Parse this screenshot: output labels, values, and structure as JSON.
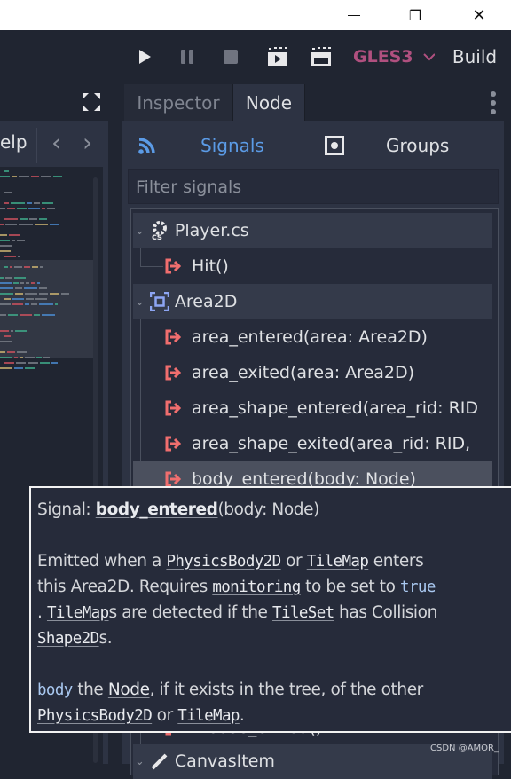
{
  "window_controls": {
    "minimize": "—",
    "restore": "❐",
    "close": "✕"
  },
  "toolbar": {
    "renderer": "GLES3",
    "build": "Build",
    "colors": {
      "renderer": "#b0507f"
    }
  },
  "left_panel": {
    "help_partial": "elp",
    "back": "‹",
    "forward": "›"
  },
  "dock": {
    "tabs": [
      {
        "label": "Inspector",
        "active": false
      },
      {
        "label": "Node",
        "active": true
      }
    ]
  },
  "node_panel": {
    "signals_label": "Signals",
    "groups_label": "Groups",
    "filter_placeholder": "Filter signals",
    "accent": "#5b9be6"
  },
  "tree": [
    {
      "label": "Player.cs",
      "type": "header",
      "icon": "csharp-script-icon"
    },
    {
      "label": "Hit()",
      "type": "signal"
    },
    {
      "label": "Area2D",
      "type": "header",
      "icon": "area2d-icon"
    },
    {
      "label": "area_entered(area: Area2D)",
      "type": "signal"
    },
    {
      "label": "area_exited(area: Area2D)",
      "type": "signal"
    },
    {
      "label": "area_shape_entered(area_rid: RID",
      "type": "signal"
    },
    {
      "label": "area_shape_exited(area_rid: RID,",
      "type": "signal"
    },
    {
      "label": "body_entered(body: Node)",
      "type": "signal",
      "hovered": true
    },
    {
      "label": "mouse_exited()",
      "type": "signal"
    },
    {
      "label": "CanvasItem",
      "type": "header",
      "icon": "canvasitem-icon"
    }
  ],
  "tooltip": {
    "l1": [
      "Signal: ",
      "body_entered",
      "(body: Node)"
    ],
    "l2": [
      "Emitted when a ",
      "PhysicsBody2D",
      " or ",
      "TileMap",
      " enters"
    ],
    "l3": [
      "this Area2D. Requires ",
      "monitoring",
      " to be set to ",
      "true"
    ],
    "l4": [
      ". ",
      "TileMap",
      "s are detected if the ",
      "TileSet",
      " has Collision"
    ],
    "l5": [
      "Shape2D",
      "s."
    ],
    "l6": [
      "body",
      " the ",
      "Node",
      ", if it exists in the tree, of the other"
    ],
    "l7": [
      "PhysicsBody2D",
      " or ",
      "TileMap",
      "."
    ]
  },
  "watermark": "CSDN @AMOR_"
}
